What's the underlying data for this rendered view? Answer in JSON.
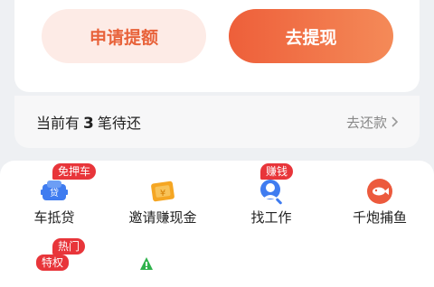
{
  "actions": {
    "apply_label": "申请提额",
    "withdraw_label": "去提现"
  },
  "repay": {
    "prefix": "当前有",
    "count": "3",
    "suffix": "笔待还",
    "link_label": "去还款"
  },
  "menu": {
    "items": [
      {
        "label": "车抵贷",
        "badge": "免押车",
        "icon": "car-loan-icon"
      },
      {
        "label": "邀请赚现金",
        "badge": "",
        "icon": "invite-cash-icon"
      },
      {
        "label": "找工作",
        "badge": "赚钱",
        "icon": "find-job-icon"
      },
      {
        "label": "千炮捕鱼",
        "badge": "",
        "icon": "fishing-game-icon"
      }
    ],
    "second_row_badge_top": "热门",
    "second_row_badge_bottom": "特权"
  },
  "colors": {
    "accent": "#ee5f3a",
    "badge": "#e8353a"
  }
}
